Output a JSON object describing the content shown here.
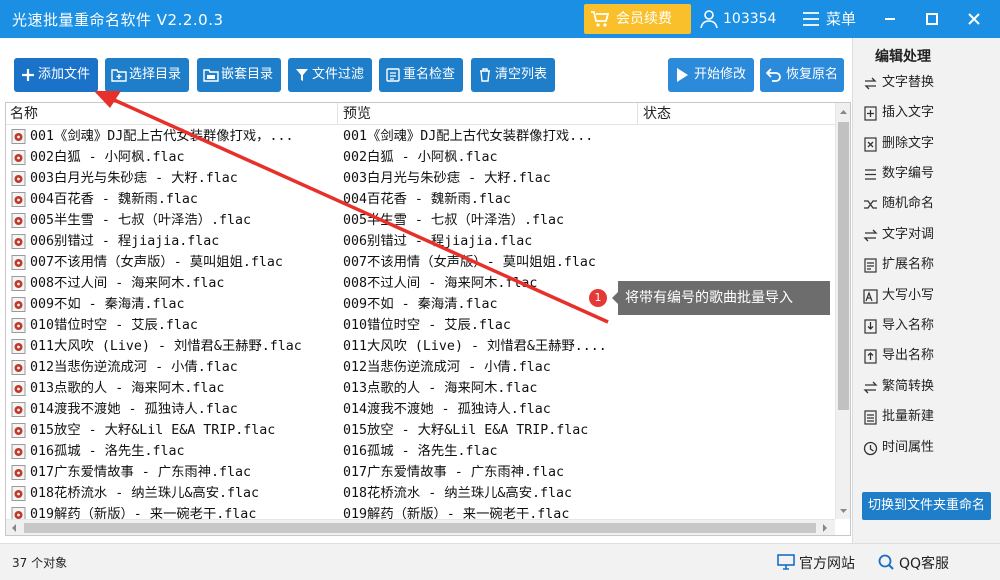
{
  "app": {
    "title": "光速批量重命名软件 V2.2.0.3"
  },
  "titlebar": {
    "vip_label": "会员续费",
    "user_id": "103354",
    "menu_label": "菜单"
  },
  "toolbar": {
    "add_file": "添加文件",
    "select_dir": "选择目录",
    "nest_dir": "嵌套目录",
    "file_filter": "文件过滤",
    "rename_check": "重名检查",
    "clear_list": "清空列表",
    "start_modify": "开始修改",
    "restore_name": "恢复原名"
  },
  "list": {
    "headers": {
      "name": "名称",
      "preview": "预览",
      "status": "状态"
    },
    "rows": [
      {
        "name": "001《剑魂》DJ配上古代女装群像打戏，...",
        "preview": "001《剑魂》DJ配上古代女装群像打戏..."
      },
      {
        "name": "002白狐 - 小阿枫.flac",
        "preview": "002白狐 - 小阿枫.flac"
      },
      {
        "name": "003白月光与朱砂痣 - 大籽.flac",
        "preview": "003白月光与朱砂痣 - 大籽.flac"
      },
      {
        "name": "004百花香 - 魏新雨.flac",
        "preview": "004百花香 - 魏新雨.flac"
      },
      {
        "name": "005半生雪 - 七叔（叶泽浩）.flac",
        "preview": "005半生雪 - 七叔（叶泽浩）.flac"
      },
      {
        "name": "006别错过 - 程jiajia.flac",
        "preview": "006别错过 - 程jiajia.flac"
      },
      {
        "name": "007不该用情（女声版）- 莫叫姐姐.flac",
        "preview": "007不该用情（女声版）- 莫叫姐姐.flac"
      },
      {
        "name": "008不过人间 - 海来阿木.flac",
        "preview": "008不过人间 - 海来阿木.flac"
      },
      {
        "name": "009不如 - 秦海清.flac",
        "preview": "009不如 - 秦海清.flac"
      },
      {
        "name": "010错位时空 - 艾辰.flac",
        "preview": "010错位时空 - 艾辰.flac"
      },
      {
        "name": "011大风吹 (Live) - 刘惜君&王赫野.flac",
        "preview": "011大风吹 (Live) - 刘惜君&王赫野...."
      },
      {
        "name": "012当悲伤逆流成河 - 小倩.flac",
        "preview": "012当悲伤逆流成河 - 小倩.flac"
      },
      {
        "name": "013点歌的人 - 海来阿木.flac",
        "preview": "013点歌的人 - 海来阿木.flac"
      },
      {
        "name": "014渡我不渡她 - 孤独诗人.flac",
        "preview": "014渡我不渡她 - 孤独诗人.flac"
      },
      {
        "name": "015放空 - 大籽&Lil E&A TRIP.flac",
        "preview": "015放空 - 大籽&Lil E&A TRIP.flac"
      },
      {
        "name": "016孤城 - 洛先生.flac",
        "preview": "016孤城 - 洛先生.flac"
      },
      {
        "name": "017广东爱情故事 - 广东雨神.flac",
        "preview": "017广东爱情故事 - 广东雨神.flac"
      },
      {
        "name": "018花桥流水 - 纳兰珠儿&高安.flac",
        "preview": "018花桥流水 - 纳兰珠儿&高安.flac"
      },
      {
        "name": "019解药（新版）- 来一碗老干.flac",
        "preview": "019解药（新版）- 来一碗老干.flac"
      }
    ]
  },
  "side": {
    "title": "编辑处理",
    "items": [
      {
        "label": "文字替换",
        "icon": "replace-icon"
      },
      {
        "label": "插入文字",
        "icon": "insert-icon"
      },
      {
        "label": "删除文字",
        "icon": "delete-text-icon"
      },
      {
        "label": "数字编号",
        "icon": "number-icon"
      },
      {
        "label": "随机命名",
        "icon": "random-icon"
      },
      {
        "label": "文字对调",
        "icon": "swap-icon"
      },
      {
        "label": "扩展名称",
        "icon": "extension-icon"
      },
      {
        "label": "大写小写",
        "icon": "case-icon"
      },
      {
        "label": "导入名称",
        "icon": "import-icon"
      },
      {
        "label": "导出名称",
        "icon": "export-icon"
      },
      {
        "label": "繁简转换",
        "icon": "convert-icon"
      },
      {
        "label": "批量新建",
        "icon": "batch-new-icon"
      },
      {
        "label": "时间属性",
        "icon": "clock-icon"
      }
    ],
    "switch_button": "切换到文件夹重命名"
  },
  "status": {
    "count": "37 个对象",
    "website": "官方网站",
    "qq": "QQ客服"
  },
  "annotation": {
    "number": "1",
    "text": "将带有编号的歌曲批量导入"
  },
  "colors": {
    "titlebar": "#1a8fe3",
    "button": "#1f7ec9",
    "vip": "#f9c02b",
    "arrow": "#e8302b",
    "callout": "#6d6d6d"
  }
}
